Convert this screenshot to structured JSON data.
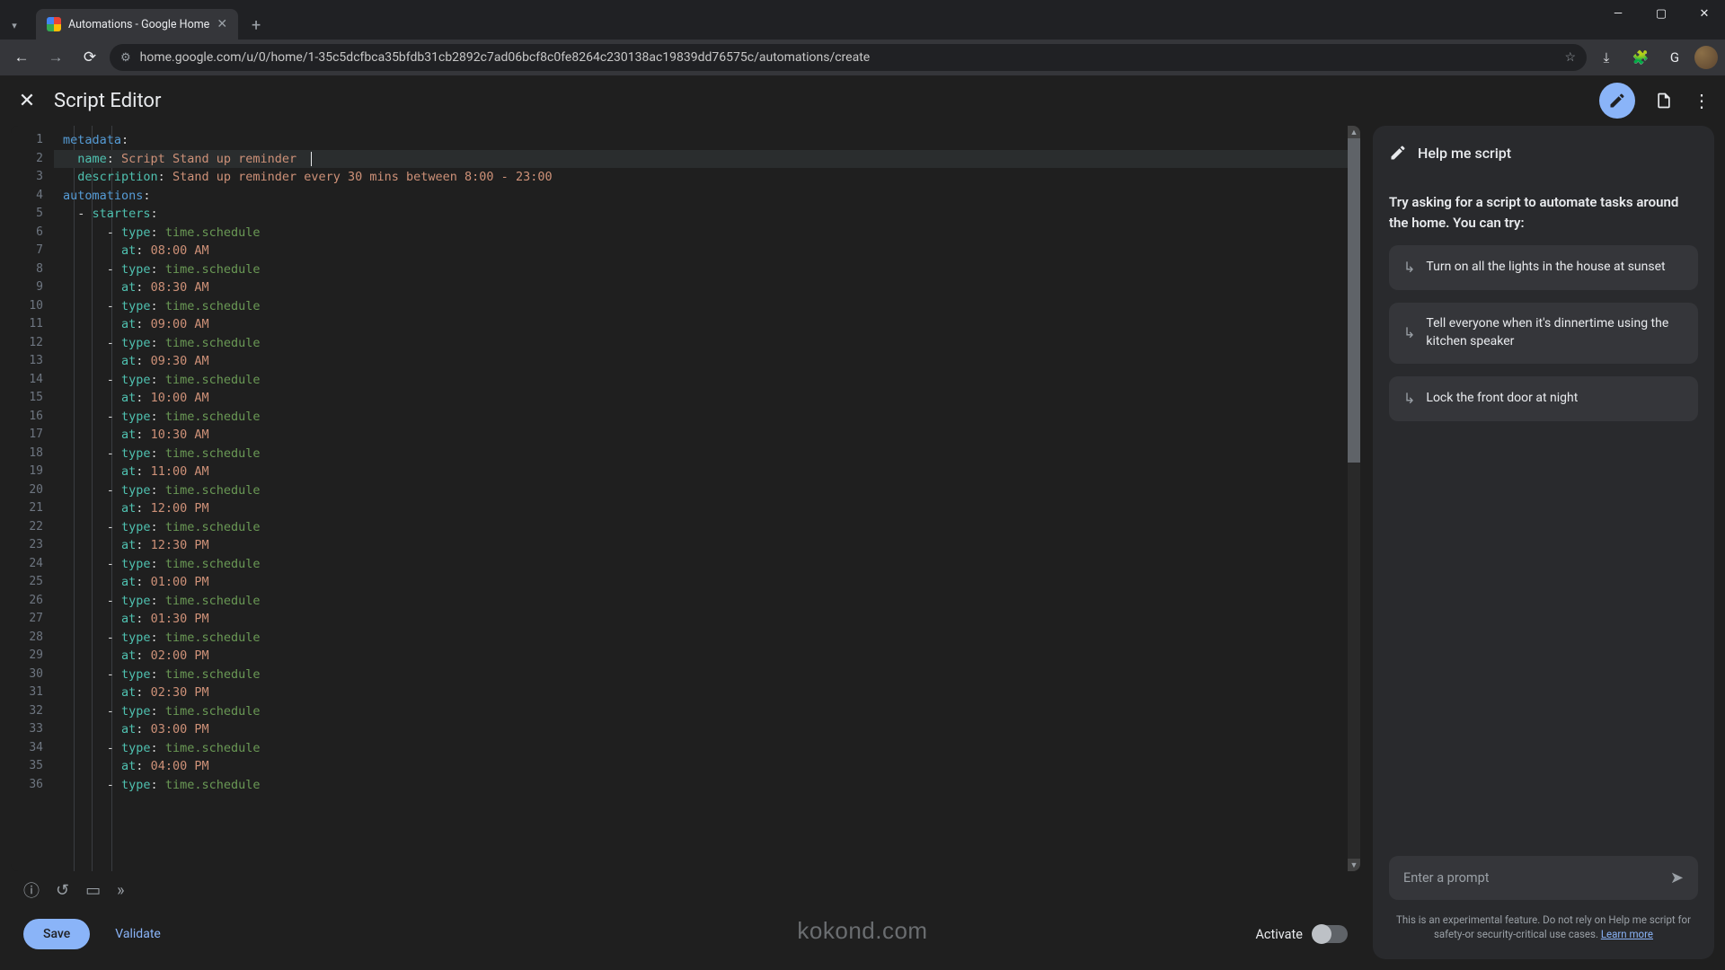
{
  "browser": {
    "tab_title": "Automations - Google Home",
    "url": "home.google.com/u/0/home/1-35c5dcfbca35bfdb31cb2892c7ad06bcf8c0fe8264c230138ac19839dd76575c/automations/create"
  },
  "header": {
    "title": "Script Editor"
  },
  "editor": {
    "lines": [
      {
        "n": 1,
        "segs": [
          {
            "c": "k-blue",
            "t": "metadata"
          },
          {
            "c": "k-white",
            "t": ":"
          }
        ]
      },
      {
        "n": 2,
        "current": true,
        "segs": [
          {
            "c": "k-white",
            "t": "  "
          },
          {
            "c": "k-teal",
            "t": "name"
          },
          {
            "c": "k-white",
            "t": ": "
          },
          {
            "c": "k-orange",
            "t": "Script Stand up reminder"
          }
        ],
        "caret": true
      },
      {
        "n": 3,
        "segs": [
          {
            "c": "k-white",
            "t": "  "
          },
          {
            "c": "k-teal",
            "t": "description"
          },
          {
            "c": "k-white",
            "t": ": "
          },
          {
            "c": "k-orange",
            "t": "Stand up reminder every 30 mins between 8:00 - 23:00"
          }
        ]
      },
      {
        "n": 4,
        "segs": [
          {
            "c": "k-blue",
            "t": "automations"
          },
          {
            "c": "k-white",
            "t": ":"
          }
        ]
      },
      {
        "n": 5,
        "segs": [
          {
            "c": "k-white",
            "t": "  - "
          },
          {
            "c": "k-teal",
            "t": "starters"
          },
          {
            "c": "k-white",
            "t": ":"
          }
        ]
      },
      {
        "n": 6,
        "segs": [
          {
            "c": "k-white",
            "t": "      - "
          },
          {
            "c": "k-teal",
            "t": "type"
          },
          {
            "c": "k-white",
            "t": ": "
          },
          {
            "c": "k-green",
            "t": "time.schedule"
          }
        ]
      },
      {
        "n": 7,
        "segs": [
          {
            "c": "k-white",
            "t": "        "
          },
          {
            "c": "k-teal",
            "t": "at"
          },
          {
            "c": "k-white",
            "t": ": "
          },
          {
            "c": "k-orange",
            "t": "08:00 AM"
          }
        ]
      },
      {
        "n": 8,
        "segs": [
          {
            "c": "k-white",
            "t": "      - "
          },
          {
            "c": "k-teal",
            "t": "type"
          },
          {
            "c": "k-white",
            "t": ": "
          },
          {
            "c": "k-green",
            "t": "time.schedule"
          }
        ]
      },
      {
        "n": 9,
        "segs": [
          {
            "c": "k-white",
            "t": "        "
          },
          {
            "c": "k-teal",
            "t": "at"
          },
          {
            "c": "k-white",
            "t": ": "
          },
          {
            "c": "k-orange",
            "t": "08:30 AM"
          }
        ]
      },
      {
        "n": 10,
        "segs": [
          {
            "c": "k-white",
            "t": "      - "
          },
          {
            "c": "k-teal",
            "t": "type"
          },
          {
            "c": "k-white",
            "t": ": "
          },
          {
            "c": "k-green",
            "t": "time.schedule"
          }
        ]
      },
      {
        "n": 11,
        "segs": [
          {
            "c": "k-white",
            "t": "        "
          },
          {
            "c": "k-teal",
            "t": "at"
          },
          {
            "c": "k-white",
            "t": ": "
          },
          {
            "c": "k-orange",
            "t": "09:00 AM"
          }
        ]
      },
      {
        "n": 12,
        "segs": [
          {
            "c": "k-white",
            "t": "      - "
          },
          {
            "c": "k-teal",
            "t": "type"
          },
          {
            "c": "k-white",
            "t": ": "
          },
          {
            "c": "k-green",
            "t": "time.schedule"
          }
        ]
      },
      {
        "n": 13,
        "segs": [
          {
            "c": "k-white",
            "t": "        "
          },
          {
            "c": "k-teal",
            "t": "at"
          },
          {
            "c": "k-white",
            "t": ": "
          },
          {
            "c": "k-orange",
            "t": "09:30 AM"
          }
        ]
      },
      {
        "n": 14,
        "segs": [
          {
            "c": "k-white",
            "t": "      - "
          },
          {
            "c": "k-teal",
            "t": "type"
          },
          {
            "c": "k-white",
            "t": ": "
          },
          {
            "c": "k-green",
            "t": "time.schedule"
          }
        ]
      },
      {
        "n": 15,
        "segs": [
          {
            "c": "k-white",
            "t": "        "
          },
          {
            "c": "k-teal",
            "t": "at"
          },
          {
            "c": "k-white",
            "t": ": "
          },
          {
            "c": "k-orange",
            "t": "10:00 AM"
          }
        ]
      },
      {
        "n": 16,
        "segs": [
          {
            "c": "k-white",
            "t": "      - "
          },
          {
            "c": "k-teal",
            "t": "type"
          },
          {
            "c": "k-white",
            "t": ": "
          },
          {
            "c": "k-green",
            "t": "time.schedule"
          }
        ]
      },
      {
        "n": 17,
        "segs": [
          {
            "c": "k-white",
            "t": "        "
          },
          {
            "c": "k-teal",
            "t": "at"
          },
          {
            "c": "k-white",
            "t": ": "
          },
          {
            "c": "k-orange",
            "t": "10:30 AM"
          }
        ]
      },
      {
        "n": 18,
        "segs": [
          {
            "c": "k-white",
            "t": "      - "
          },
          {
            "c": "k-teal",
            "t": "type"
          },
          {
            "c": "k-white",
            "t": ": "
          },
          {
            "c": "k-green",
            "t": "time.schedule"
          }
        ]
      },
      {
        "n": 19,
        "segs": [
          {
            "c": "k-white",
            "t": "        "
          },
          {
            "c": "k-teal",
            "t": "at"
          },
          {
            "c": "k-white",
            "t": ": "
          },
          {
            "c": "k-orange",
            "t": "11:00 AM"
          }
        ]
      },
      {
        "n": 20,
        "segs": [
          {
            "c": "k-white",
            "t": "      - "
          },
          {
            "c": "k-teal",
            "t": "type"
          },
          {
            "c": "k-white",
            "t": ": "
          },
          {
            "c": "k-green",
            "t": "time.schedule"
          }
        ]
      },
      {
        "n": 21,
        "segs": [
          {
            "c": "k-white",
            "t": "        "
          },
          {
            "c": "k-teal",
            "t": "at"
          },
          {
            "c": "k-white",
            "t": ": "
          },
          {
            "c": "k-orange",
            "t": "12:00 PM"
          }
        ]
      },
      {
        "n": 22,
        "segs": [
          {
            "c": "k-white",
            "t": "      - "
          },
          {
            "c": "k-teal",
            "t": "type"
          },
          {
            "c": "k-white",
            "t": ": "
          },
          {
            "c": "k-green",
            "t": "time.schedule"
          }
        ]
      },
      {
        "n": 23,
        "segs": [
          {
            "c": "k-white",
            "t": "        "
          },
          {
            "c": "k-teal",
            "t": "at"
          },
          {
            "c": "k-white",
            "t": ": "
          },
          {
            "c": "k-orange",
            "t": "12:30 PM"
          }
        ]
      },
      {
        "n": 24,
        "segs": [
          {
            "c": "k-white",
            "t": "      - "
          },
          {
            "c": "k-teal",
            "t": "type"
          },
          {
            "c": "k-white",
            "t": ": "
          },
          {
            "c": "k-green",
            "t": "time.schedule"
          }
        ]
      },
      {
        "n": 25,
        "segs": [
          {
            "c": "k-white",
            "t": "        "
          },
          {
            "c": "k-teal",
            "t": "at"
          },
          {
            "c": "k-white",
            "t": ": "
          },
          {
            "c": "k-orange",
            "t": "01:00 PM"
          }
        ]
      },
      {
        "n": 26,
        "segs": [
          {
            "c": "k-white",
            "t": "      - "
          },
          {
            "c": "k-teal",
            "t": "type"
          },
          {
            "c": "k-white",
            "t": ": "
          },
          {
            "c": "k-green",
            "t": "time.schedule"
          }
        ]
      },
      {
        "n": 27,
        "segs": [
          {
            "c": "k-white",
            "t": "        "
          },
          {
            "c": "k-teal",
            "t": "at"
          },
          {
            "c": "k-white",
            "t": ": "
          },
          {
            "c": "k-orange",
            "t": "01:30 PM"
          }
        ]
      },
      {
        "n": 28,
        "segs": [
          {
            "c": "k-white",
            "t": "      - "
          },
          {
            "c": "k-teal",
            "t": "type"
          },
          {
            "c": "k-white",
            "t": ": "
          },
          {
            "c": "k-green",
            "t": "time.schedule"
          }
        ]
      },
      {
        "n": 29,
        "segs": [
          {
            "c": "k-white",
            "t": "        "
          },
          {
            "c": "k-teal",
            "t": "at"
          },
          {
            "c": "k-white",
            "t": ": "
          },
          {
            "c": "k-orange",
            "t": "02:00 PM"
          }
        ]
      },
      {
        "n": 30,
        "segs": [
          {
            "c": "k-white",
            "t": "      - "
          },
          {
            "c": "k-teal",
            "t": "type"
          },
          {
            "c": "k-white",
            "t": ": "
          },
          {
            "c": "k-green",
            "t": "time.schedule"
          }
        ]
      },
      {
        "n": 31,
        "segs": [
          {
            "c": "k-white",
            "t": "        "
          },
          {
            "c": "k-teal",
            "t": "at"
          },
          {
            "c": "k-white",
            "t": ": "
          },
          {
            "c": "k-orange",
            "t": "02:30 PM"
          }
        ]
      },
      {
        "n": 32,
        "segs": [
          {
            "c": "k-white",
            "t": "      - "
          },
          {
            "c": "k-teal",
            "t": "type"
          },
          {
            "c": "k-white",
            "t": ": "
          },
          {
            "c": "k-green",
            "t": "time.schedule"
          }
        ]
      },
      {
        "n": 33,
        "segs": [
          {
            "c": "k-white",
            "t": "        "
          },
          {
            "c": "k-teal",
            "t": "at"
          },
          {
            "c": "k-white",
            "t": ": "
          },
          {
            "c": "k-orange",
            "t": "03:00 PM"
          }
        ]
      },
      {
        "n": 34,
        "segs": [
          {
            "c": "k-white",
            "t": "      - "
          },
          {
            "c": "k-teal",
            "t": "type"
          },
          {
            "c": "k-white",
            "t": ": "
          },
          {
            "c": "k-green",
            "t": "time.schedule"
          }
        ]
      },
      {
        "n": 35,
        "segs": [
          {
            "c": "k-white",
            "t": "        "
          },
          {
            "c": "k-teal",
            "t": "at"
          },
          {
            "c": "k-white",
            "t": ": "
          },
          {
            "c": "k-orange",
            "t": "04:00 PM"
          }
        ]
      },
      {
        "n": 36,
        "segs": [
          {
            "c": "k-white",
            "t": "      - "
          },
          {
            "c": "k-teal",
            "t": "type"
          },
          {
            "c": "k-white",
            "t": ": "
          },
          {
            "c": "k-green",
            "t": "time.schedule"
          }
        ]
      }
    ]
  },
  "footer": {
    "save": "Save",
    "validate": "Validate",
    "activate": "Activate"
  },
  "side": {
    "title": "Help me script",
    "prompt_intro": "Try asking for a script to automate tasks around the home. You can try:",
    "suggestions": [
      "Turn on all the lights in the house at sunset",
      "Tell everyone when it's dinnertime using the kitchen speaker",
      "Lock the front door at night"
    ],
    "prompt_placeholder": "Enter a prompt",
    "disclaimer_a": "This is an experimental feature. Do not rely on Help me script for safety-or security-critical use cases. ",
    "disclaimer_link": "Learn more"
  },
  "watermark": "kokond.com"
}
